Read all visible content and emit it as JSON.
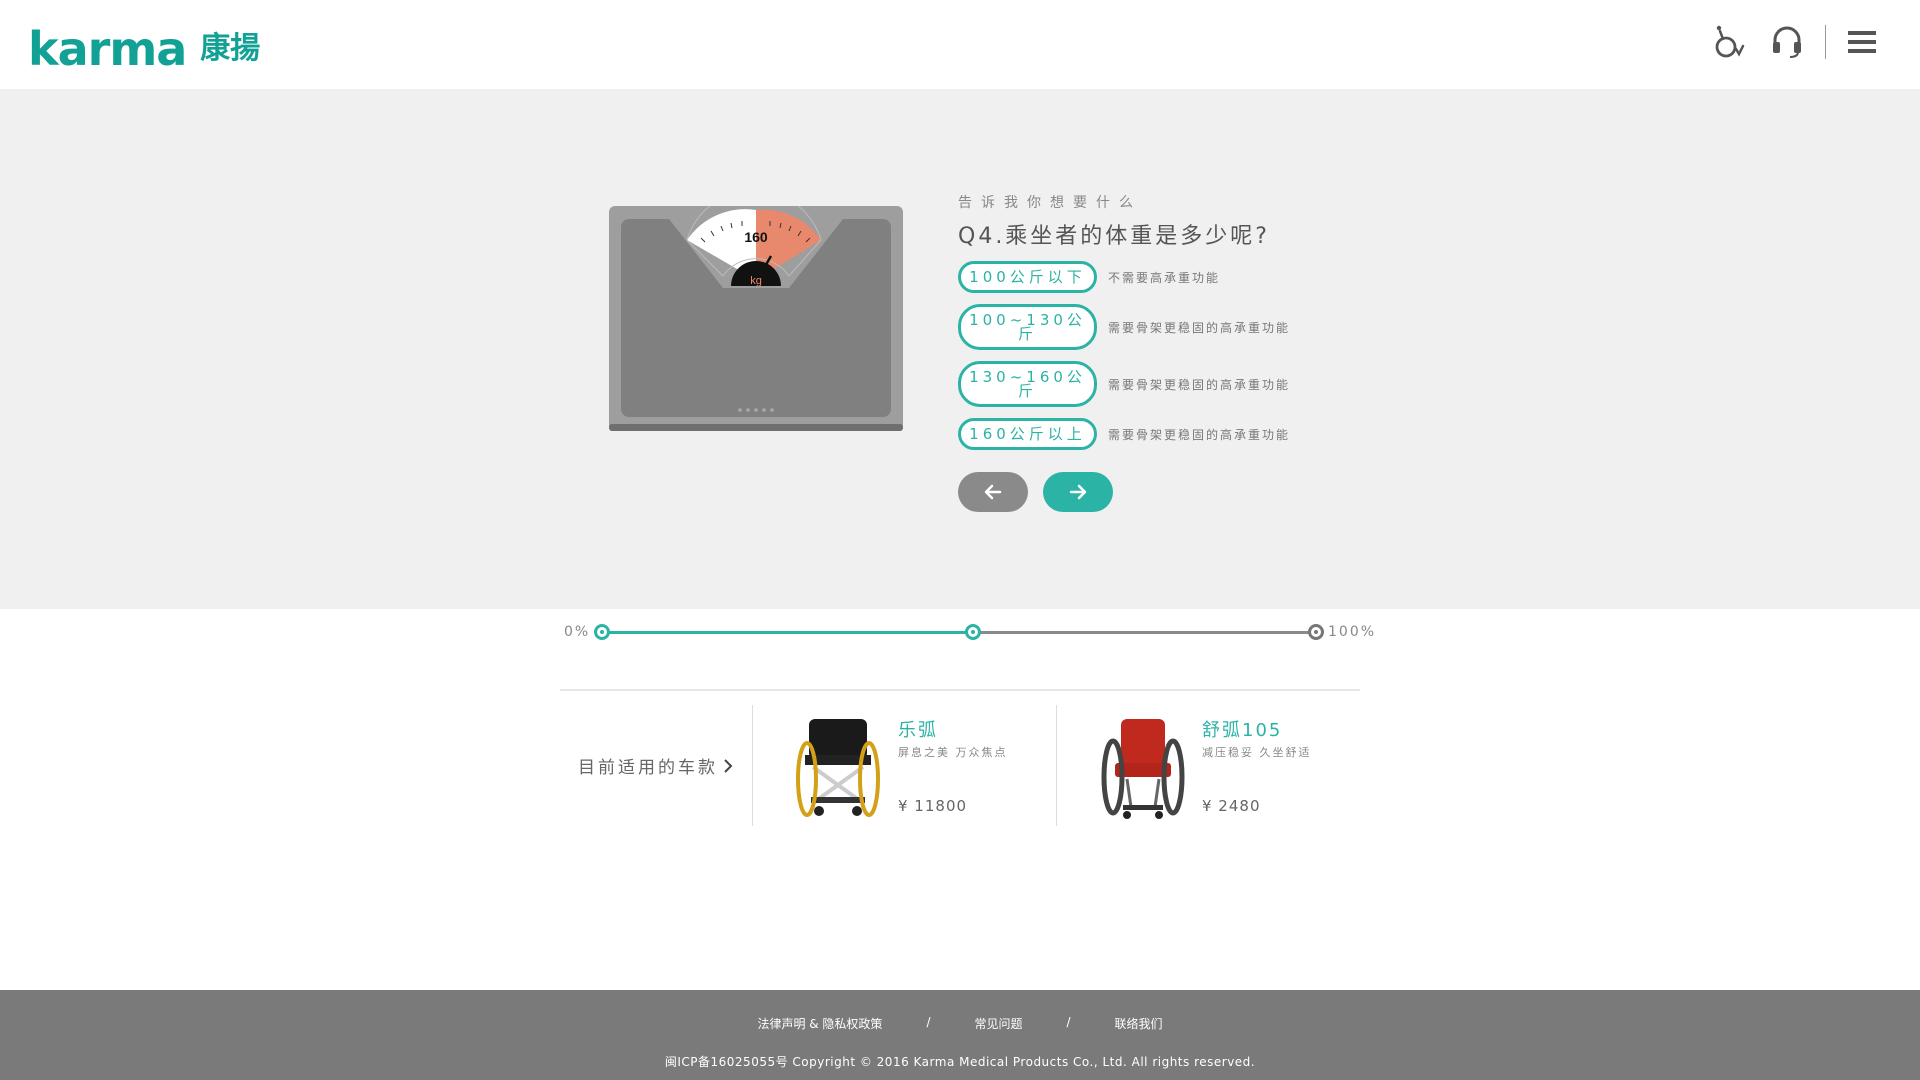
{
  "header": {
    "logo_word": "karma",
    "logo_cn": "康揚",
    "icons": [
      "wheelchair-icon",
      "headset-icon",
      "menu-icon"
    ]
  },
  "colors": {
    "accent": "#2bb3a5",
    "brand": "#12a195",
    "scale_body": "#808080",
    "needle_zone": "#e8896e"
  },
  "scale": {
    "reading": "160",
    "unit": "kg"
  },
  "question": {
    "tagline": "告诉我你想要什么",
    "title": "Q4.乘坐者的体重是多少呢?",
    "options": [
      {
        "label": "100公斤以下",
        "note": "不需要高承重功能"
      },
      {
        "label": "100~130公斤",
        "note": "需要骨架更稳固的高承重功能"
      },
      {
        "label": "130~160公斤",
        "note": "需要骨架更稳固的高承重功能"
      },
      {
        "label": "160公斤以上",
        "note": "需要骨架更稳固的高承重功能"
      }
    ]
  },
  "progress": {
    "start_label": "0%",
    "end_label": "100%",
    "value": 0.52
  },
  "models": {
    "label": "目前适用的车款",
    "items": [
      {
        "name": "乐弧",
        "desc": "屏息之美 万众焦点",
        "price": "¥ 11800"
      },
      {
        "name": "舒弧105",
        "desc": "减压稳妥 久坐舒适",
        "price": "¥ 2480"
      }
    ]
  },
  "footer": {
    "links": [
      "法律声明 & 隐私权政策",
      "常见问题",
      "联络我们"
    ],
    "separator": "/",
    "copyright": "闽ICP备16025055号 Copyright © 2016 Karma Medical Products Co., Ltd. All rights reserved."
  }
}
